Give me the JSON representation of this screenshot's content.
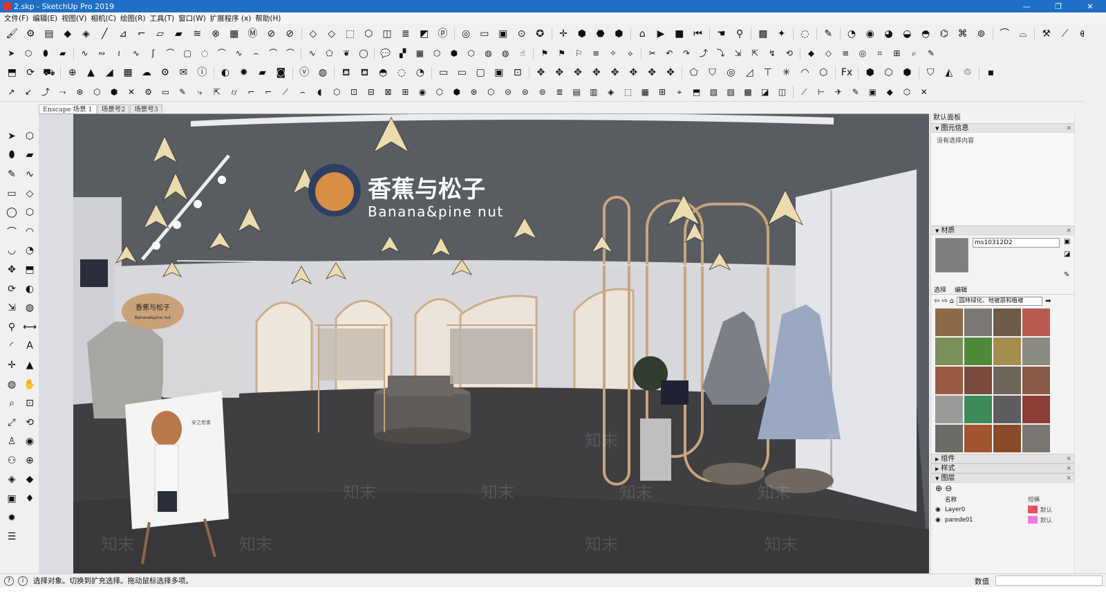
{
  "window": {
    "title": "2.skp - SketchUp Pro 2019",
    "controls": [
      "—",
      "❐",
      "✕"
    ]
  },
  "menu": [
    "文件(F)",
    "编辑(E)",
    "视图(V)",
    "相机(C)",
    "绘图(R)",
    "工具(T)",
    "窗口(W)",
    "扩展程序 (x)",
    "帮助(H)"
  ],
  "toolbars": {
    "row1": [
      {
        "name": "paint-bucket-icon",
        "glyph": "🖌"
      },
      {
        "name": "gear-icon",
        "glyph": "⚙"
      },
      {
        "name": "film-icon",
        "glyph": "▤"
      },
      {
        "name": "box-red-icon",
        "glyph": "◆"
      },
      {
        "name": "cube-icon",
        "glyph": "◈"
      },
      {
        "name": "line-icon",
        "glyph": "╱"
      },
      {
        "name": "stair-icon",
        "glyph": "⊿"
      },
      {
        "name": "edge-icon",
        "glyph": "⌐"
      },
      {
        "name": "face-icon",
        "glyph": "▱"
      },
      {
        "name": "solid-icon",
        "glyph": "▰"
      },
      {
        "name": "stack-icon",
        "glyph": "≋"
      },
      {
        "name": "cross-box-icon",
        "glyph": "⊗"
      },
      {
        "name": "panel-icon",
        "glyph": "▦"
      },
      {
        "name": "m-icon",
        "glyph": "Ⓜ"
      },
      {
        "name": "stop-icon",
        "glyph": "⊘"
      },
      {
        "name": "cancel-icon",
        "glyph": "⊘"
      },
      {
        "name": "sep"
      },
      {
        "name": "blue-box-icon",
        "glyph": "◇"
      },
      {
        "name": "white-box-icon",
        "glyph": "◇"
      },
      {
        "name": "wire-box-icon",
        "glyph": "⬚"
      },
      {
        "name": "shape-icon",
        "glyph": "⬡"
      },
      {
        "name": "tile-icon",
        "glyph": "◫"
      },
      {
        "name": "stack2-icon",
        "glyph": "≣"
      },
      {
        "name": "tile2-icon",
        "glyph": "◩"
      },
      {
        "name": "p-icon",
        "glyph": "ⓟ"
      },
      {
        "name": "sep"
      },
      {
        "name": "orbit-icon",
        "glyph": "◎"
      },
      {
        "name": "display-icon",
        "glyph": "▭"
      },
      {
        "name": "camera-icon",
        "glyph": "▣"
      },
      {
        "name": "target-icon",
        "glyph": "⊙"
      },
      {
        "name": "badge-icon",
        "glyph": "✪"
      },
      {
        "name": "sep"
      },
      {
        "name": "move-axes-icon",
        "glyph": "✛"
      },
      {
        "name": "iso-icon",
        "glyph": "⬢"
      },
      {
        "name": "top-icon",
        "glyph": "⬣"
      },
      {
        "name": "front-icon",
        "glyph": "⬢"
      },
      {
        "name": "sep"
      },
      {
        "name": "house-icon",
        "glyph": "⌂"
      },
      {
        "name": "play-icon",
        "glyph": "▶"
      },
      {
        "name": "stop-square-icon",
        "glyph": "■"
      },
      {
        "name": "rewind-icon",
        "glyph": "⏮"
      },
      {
        "name": "sep"
      },
      {
        "name": "hand-icon",
        "glyph": "☚"
      },
      {
        "name": "pin-icon",
        "glyph": "⚲"
      },
      {
        "name": "sep"
      },
      {
        "name": "color-icon",
        "glyph": "▩"
      },
      {
        "name": "magic-icon",
        "glyph": "✦"
      },
      {
        "name": "sep"
      },
      {
        "name": "tag-icon",
        "glyph": "◌"
      },
      {
        "name": "sep"
      },
      {
        "name": "brush-icon",
        "glyph": "✎"
      },
      {
        "name": "sep"
      },
      {
        "name": "shape-a-icon",
        "glyph": "◔"
      },
      {
        "name": "shape-b-icon",
        "glyph": "◉"
      },
      {
        "name": "shape-c-icon",
        "glyph": "◕"
      },
      {
        "name": "shape-d-icon",
        "glyph": "◒"
      },
      {
        "name": "shape-e-icon",
        "glyph": "◓"
      },
      {
        "name": "shape-f-icon",
        "glyph": "⌬"
      },
      {
        "name": "shape-g-icon",
        "glyph": "⌘"
      },
      {
        "name": "shape-h-icon",
        "glyph": "⊚"
      },
      {
        "name": "sep"
      },
      {
        "name": "arc-icon",
        "glyph": "⌒"
      },
      {
        "name": "arc2-icon",
        "glyph": "⌓"
      },
      {
        "name": "sep"
      },
      {
        "name": "tools-icon",
        "glyph": "⚒"
      },
      {
        "name": "knife-icon",
        "glyph": "⟋"
      },
      {
        "name": "mark-icon",
        "glyph": "⊕"
      }
    ],
    "row2": [
      {
        "name": "select-arrow-icon",
        "glyph": "➤"
      },
      {
        "name": "component-icon",
        "glyph": "⬡"
      },
      {
        "name": "paint-icon",
        "glyph": "⬮"
      },
      {
        "name": "eraser-icon",
        "glyph": "▰"
      },
      {
        "name": "sep"
      },
      {
        "name": "curve-a-icon",
        "glyph": "∿"
      },
      {
        "name": "curve-b-icon",
        "glyph": "∾"
      },
      {
        "name": "curve-c-icon",
        "glyph": "≀"
      },
      {
        "name": "curve-d-icon",
        "glyph": "∿"
      },
      {
        "name": "curve-e-icon",
        "glyph": "ʃ"
      },
      {
        "name": "curve-f-icon",
        "glyph": "⌒"
      },
      {
        "name": "rect-icon",
        "glyph": "▢"
      },
      {
        "name": "circle-icon",
        "glyph": "◌"
      },
      {
        "name": "curve-g-icon",
        "glyph": "⌒"
      },
      {
        "name": "curve-h-icon",
        "glyph": "∿"
      },
      {
        "name": "curve-i-icon",
        "glyph": "⌢"
      },
      {
        "name": "curve-j-icon",
        "glyph": "⌒"
      },
      {
        "name": "curve-k-icon",
        "glyph": "⌒"
      },
      {
        "name": "sep"
      },
      {
        "name": "wave-icon",
        "glyph": "∿"
      },
      {
        "name": "poly-icon",
        "glyph": "⬠"
      },
      {
        "name": "leaf-icon",
        "glyph": "❦"
      },
      {
        "name": "ring-icon",
        "glyph": "◯"
      },
      {
        "name": "sep"
      },
      {
        "name": "chat-icon",
        "glyph": "💬"
      },
      {
        "name": "stack3-icon",
        "glyph": "▞"
      },
      {
        "name": "grid-icon",
        "glyph": "▦"
      },
      {
        "name": "cube-a-icon",
        "glyph": "⬡"
      },
      {
        "name": "cube-b-icon",
        "glyph": "⬢"
      },
      {
        "name": "cube-c-icon",
        "glyph": "⬡"
      },
      {
        "name": "ball-icon",
        "glyph": "◍"
      },
      {
        "name": "ball2-icon",
        "glyph": "◍"
      },
      {
        "name": "pointer-icon",
        "glyph": "☝"
      },
      {
        "name": "sep"
      },
      {
        "name": "m-a-icon",
        "glyph": "⚑"
      },
      {
        "name": "m-b-icon",
        "glyph": "⚑"
      },
      {
        "name": "m-c-icon",
        "glyph": "⚐"
      },
      {
        "name": "m-d-icon",
        "glyph": "≡"
      },
      {
        "name": "m-e-icon",
        "glyph": "✧"
      },
      {
        "name": "m-f-icon",
        "glyph": "⟡"
      },
      {
        "name": "sep"
      },
      {
        "name": "cut-icon",
        "glyph": "✂"
      },
      {
        "name": "n-a-icon",
        "glyph": "↶"
      },
      {
        "name": "n-b-icon",
        "glyph": "↷"
      },
      {
        "name": "n-c-icon",
        "glyph": "⤴"
      },
      {
        "name": "n-d-icon",
        "glyph": "⤵"
      },
      {
        "name": "n-e-icon",
        "glyph": "⇲"
      },
      {
        "name": "n-f-icon",
        "glyph": "⇱"
      },
      {
        "name": "n-g-icon",
        "glyph": "↯"
      },
      {
        "name": "n-h-icon",
        "glyph": "⟲"
      },
      {
        "name": "sep"
      },
      {
        "name": "o-a-icon",
        "glyph": "◆"
      },
      {
        "name": "o-b-icon",
        "glyph": "◇"
      },
      {
        "name": "o-c-icon",
        "glyph": "≡"
      },
      {
        "name": "o-d-icon",
        "glyph": "◎"
      },
      {
        "name": "o-e-icon",
        "glyph": "⌗"
      },
      {
        "name": "o-f-icon",
        "glyph": "⊞"
      },
      {
        "name": "o-g-icon",
        "glyph": "⌕"
      },
      {
        "name": "o-h-icon",
        "glyph": "✎"
      }
    ],
    "row3": [
      {
        "name": "section-icon",
        "glyph": "⬒"
      },
      {
        "name": "refresh-icon",
        "glyph": "⟳"
      },
      {
        "name": "truck-icon",
        "glyph": "⛟"
      },
      {
        "name": "sep"
      },
      {
        "name": "add-icon",
        "glyph": "⊕"
      },
      {
        "name": "tree-icon",
        "glyph": "▲"
      },
      {
        "name": "sun-icon",
        "glyph": "◢"
      },
      {
        "name": "checker-icon",
        "glyph": "▩"
      },
      {
        "name": "cloud-icon",
        "glyph": "☁"
      },
      {
        "name": "settings-icon",
        "glyph": "⚙"
      },
      {
        "name": "mail-icon",
        "glyph": "✉"
      },
      {
        "name": "info-icon",
        "glyph": "ⓘ"
      },
      {
        "name": "sep"
      },
      {
        "name": "render-icon",
        "glyph": "◐"
      },
      {
        "name": "gear-red-icon",
        "glyph": "✹"
      },
      {
        "name": "folder-icon",
        "glyph": "▰"
      },
      {
        "name": "photo-icon",
        "glyph": "◙"
      },
      {
        "name": "sep"
      },
      {
        "name": "v-icon",
        "glyph": "ⓥ"
      },
      {
        "name": "orbit2-icon",
        "glyph": "◍"
      },
      {
        "name": "sep"
      },
      {
        "name": "teapot-a-icon",
        "glyph": "⛾"
      },
      {
        "name": "teapot-b-icon",
        "glyph": "⛾"
      },
      {
        "name": "bowl-icon",
        "glyph": "◓"
      },
      {
        "name": "wave-ring-icon",
        "glyph": "◌"
      },
      {
        "name": "swirl-icon",
        "glyph": "◔"
      },
      {
        "name": "sep"
      },
      {
        "name": "tv-icon",
        "glyph": "▭"
      },
      {
        "name": "tv2-icon",
        "glyph": "▭"
      },
      {
        "name": "window-icon",
        "glyph": "▢"
      },
      {
        "name": "window2-icon",
        "glyph": "▣"
      },
      {
        "name": "lock-icon",
        "glyph": "⊡"
      },
      {
        "name": "sep"
      },
      {
        "name": "axis-a-icon",
        "glyph": "✥"
      },
      {
        "name": "axis-b-icon",
        "glyph": "✥"
      },
      {
        "name": "axis-c-icon",
        "glyph": "✥"
      },
      {
        "name": "axis-d-icon",
        "glyph": "✥"
      },
      {
        "name": "axis-e-icon",
        "glyph": "✥"
      },
      {
        "name": "axis-f-icon",
        "glyph": "✥"
      },
      {
        "name": "axis-g-icon",
        "glyph": "✥"
      },
      {
        "name": "axis-h-icon",
        "glyph": "✥"
      },
      {
        "name": "sep"
      },
      {
        "name": "shape-i-icon",
        "glyph": "⬠"
      },
      {
        "name": "shape-j-icon",
        "glyph": "⛉"
      },
      {
        "name": "shape-k-icon",
        "glyph": "◎"
      },
      {
        "name": "shape-l-icon",
        "glyph": "◿"
      },
      {
        "name": "shape-m-icon",
        "glyph": "⊤"
      },
      {
        "name": "shape-n-icon",
        "glyph": "✳"
      },
      {
        "name": "shape-o-icon",
        "glyph": "◠"
      },
      {
        "name": "shape-p-icon",
        "glyph": "⬡"
      },
      {
        "name": "sep"
      },
      {
        "name": "fx-icon",
        "glyph": "Fx"
      },
      {
        "name": "sep"
      },
      {
        "name": "cube-gold-icon",
        "glyph": "⬢"
      },
      {
        "name": "cube-white-icon",
        "glyph": "⬡"
      },
      {
        "name": "cube-gray-icon",
        "glyph": "⬢"
      },
      {
        "name": "sep"
      },
      {
        "name": "shield-icon",
        "glyph": "⛉"
      },
      {
        "name": "shapes-icon",
        "glyph": "◭"
      },
      {
        "name": "recycle-icon",
        "glyph": "♲"
      },
      {
        "name": "sep"
      },
      {
        "name": "dot-icon",
        "glyph": "▪"
      }
    ],
    "row4": [
      {
        "name": "x-a-icon",
        "glyph": "↗"
      },
      {
        "name": "x-b-icon",
        "glyph": "↙"
      },
      {
        "name": "x-c-icon",
        "glyph": "⤴"
      },
      {
        "name": "x-d-icon",
        "glyph": "⤳"
      },
      {
        "name": "x-e-icon",
        "glyph": "⊛"
      },
      {
        "name": "x-f-icon",
        "glyph": "⬡"
      },
      {
        "name": "x-g-icon",
        "glyph": "⬢"
      },
      {
        "name": "x-h-icon",
        "glyph": "✕"
      },
      {
        "name": "x-i-icon",
        "glyph": "⚙"
      },
      {
        "name": "x-j-icon",
        "glyph": "▭"
      },
      {
        "name": "x-k-icon",
        "glyph": "✎"
      },
      {
        "name": "x-l-icon",
        "glyph": "⤷"
      },
      {
        "name": "x-m-icon",
        "glyph": "⇱"
      },
      {
        "name": "x-n-icon",
        "glyph": "⌭"
      },
      {
        "name": "x-o-icon",
        "glyph": "⌐"
      },
      {
        "name": "x-p-icon",
        "glyph": "⌐"
      },
      {
        "name": "x-q-icon",
        "glyph": "⟋"
      },
      {
        "name": "x-r-icon",
        "glyph": "⌢"
      },
      {
        "name": "x-s-icon",
        "glyph": "◖"
      },
      {
        "name": "x-t-icon",
        "glyph": "⬡"
      },
      {
        "name": "x-u-icon",
        "glyph": "⊡"
      },
      {
        "name": "x-v-icon",
        "glyph": "⊟"
      },
      {
        "name": "x-w-icon",
        "glyph": "⊠"
      },
      {
        "name": "x-x-icon",
        "glyph": "⊞"
      },
      {
        "name": "x-y-icon",
        "glyph": "◉"
      },
      {
        "name": "x-z-icon",
        "glyph": "⬡"
      },
      {
        "name": "y-a-icon",
        "glyph": "⬢"
      },
      {
        "name": "y-b-icon",
        "glyph": "⊛"
      },
      {
        "name": "y-c-icon",
        "glyph": "⬡"
      },
      {
        "name": "y-d-icon",
        "glyph": "⊝"
      },
      {
        "name": "y-e-icon",
        "glyph": "⊜"
      },
      {
        "name": "y-f-icon",
        "glyph": "⊚"
      },
      {
        "name": "y-g-icon",
        "glyph": "≣"
      },
      {
        "name": "y-h-icon",
        "glyph": "▤"
      },
      {
        "name": "y-i-icon",
        "glyph": "▥"
      },
      {
        "name": "y-j-icon",
        "glyph": "◈"
      },
      {
        "name": "y-k-icon",
        "glyph": "⬚"
      },
      {
        "name": "y-l-icon",
        "glyph": "▦"
      },
      {
        "name": "y-m-icon",
        "glyph": "⊞"
      },
      {
        "name": "y-n-icon",
        "glyph": "⌖"
      },
      {
        "name": "y-o-icon",
        "glyph": "⬒"
      },
      {
        "name": "y-p-icon",
        "glyph": "▧"
      },
      {
        "name": "y-q-icon",
        "glyph": "▨"
      },
      {
        "name": "y-r-icon",
        "glyph": "▩"
      },
      {
        "name": "y-s-icon",
        "glyph": "◪"
      },
      {
        "name": "y-t-icon",
        "glyph": "◫"
      },
      {
        "name": "sep"
      },
      {
        "name": "ruler-icon",
        "glyph": "⟋"
      },
      {
        "name": "dim-icon",
        "glyph": "⊢"
      },
      {
        "name": "bird-icon",
        "glyph": "✈"
      },
      {
        "name": "pencil-icon",
        "glyph": "✎"
      },
      {
        "name": "box-orange-icon",
        "glyph": "▣"
      },
      {
        "name": "box-blue-icon",
        "glyph": "◆"
      },
      {
        "name": "cube-sketch-icon",
        "glyph": "⬡"
      },
      {
        "name": "close-red-icon",
        "glyph": "✕"
      }
    ]
  },
  "left_tools": [
    [
      "select-icon",
      "➤",
      "component-make-icon",
      "⬡"
    ],
    [
      "paint-bucket-tool-icon",
      "⬮",
      "eraser-tool-icon",
      "▰"
    ],
    [
      "pencil-tool-icon",
      "✎",
      "freehand-tool-icon",
      "∿"
    ],
    [
      "rectangle-tool-icon",
      "▭",
      "rotated-rect-tool-icon",
      "◇"
    ],
    [
      "circle-tool-icon",
      "◯",
      "polygon-tool-icon",
      "⬡"
    ],
    [
      "arc-tool-icon",
      "⌒",
      "arc2-tool-icon",
      "◠"
    ],
    [
      "arc3-tool-icon",
      "◡",
      "pie-tool-icon",
      "◔"
    ],
    [
      "move-tool-icon",
      "✥",
      "push-pull-tool-icon",
      "⬒"
    ],
    [
      "rotate-tool-icon",
      "⟳",
      "follow-me-tool-icon",
      "◐"
    ],
    [
      "scale-tool-icon",
      "⇲",
      "offset-tool-icon",
      "◍"
    ],
    [
      "tape-tool-icon",
      "⚲",
      "dimension-tool-icon",
      "⟷"
    ],
    [
      "protractor-tool-icon",
      "◜",
      "text-tool-icon",
      "A"
    ],
    [
      "axes-tool-icon",
      "✛",
      "3d-text-tool-icon",
      "▲"
    ],
    [
      "orbit-tool-icon",
      "◍",
      "pan-tool-icon",
      "✋"
    ],
    [
      "zoom-tool-icon",
      "⌕",
      "zoom-window-tool-icon",
      "⊡"
    ],
    [
      "zoom-extents-tool-icon",
      "⤢",
      "prev-view-tool-icon",
      "⟲"
    ],
    [
      "walk-tool-icon",
      "♙",
      "look-tool-icon",
      "◉"
    ],
    [
      "footprint-tool-icon",
      "⚇",
      "position-camera-tool-icon",
      "⊕"
    ],
    [
      "section-plane-tool-icon",
      "◈",
      "section-fill-tool-icon",
      "◆"
    ],
    [
      "warehouse-tool-icon",
      "▣",
      "ruby-tool-icon",
      "♦"
    ],
    [
      "sun-gear-tool-icon",
      "✹",
      "",
      ""
    ],
    [
      "outliner-tool-icon",
      "☰",
      "",
      ""
    ]
  ],
  "scene_tabs": [
    "Enscape 场景 1",
    "场景号2",
    "场景号3"
  ],
  "viewport": {
    "brand_name_cn": "香蕉与松子",
    "brand_name_en": "Banana&pine nut",
    "small_logo_cn": "香蕉与松子",
    "small_logo_en": "Banana&pine nut",
    "poster_text_cn": "安之若素",
    "watermark": "知末"
  },
  "tray": {
    "title": "默认面板",
    "entity_info": {
      "label": "图元信息",
      "empty_text": "没有选择内容"
    },
    "materials": {
      "label": "材质",
      "name_value": "ms10312D2",
      "tab_select": "选择",
      "tab_edit": "编辑",
      "collection_value": "园林绿化、地被层和植被",
      "swatch_colors": [
        "#8c6a4a",
        "#7b7772",
        "#6e5b48",
        "#b75a4f",
        "#7a8f5a",
        "#4e8a3a",
        "#a58d4e",
        "#8a8a82",
        "#9c5a45",
        "#7a4a3c",
        "#6d6558",
        "#8a5a48",
        "#9a9a98",
        "#3d8a5a",
        "#5d5d60",
        "#8e3d36",
        "#6d6b65",
        "#a0552e",
        "#8a4a2a",
        "#7a7672"
      ]
    },
    "components": {
      "label": "组件"
    },
    "styles": {
      "label": "样式"
    },
    "layers": {
      "label": "图层",
      "col_name": "名称",
      "col_dash": "短横",
      "rows": [
        {
          "name": "Layer0",
          "color": "#e8505a",
          "dash": "默认"
        },
        {
          "name": "parede01",
          "color": "#f07ad8",
          "dash": "默认"
        }
      ]
    }
  },
  "status": {
    "hint": "选择对象。切换到扩充选择。拖动鼠标选择多项。",
    "measure_label": "数值"
  }
}
